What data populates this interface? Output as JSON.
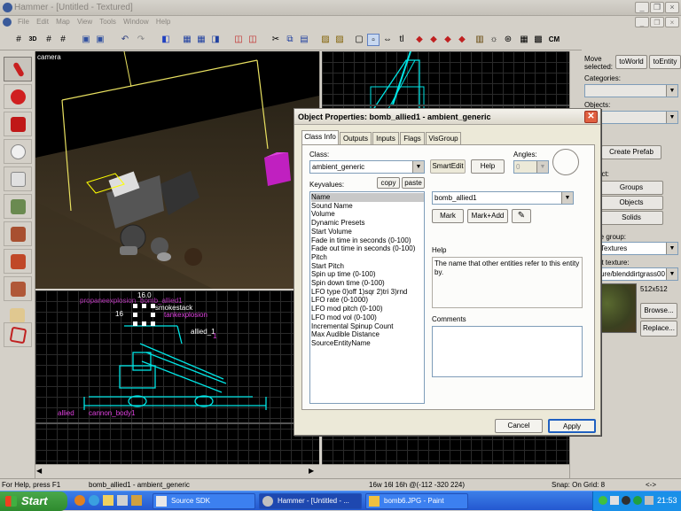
{
  "window": {
    "title": "Hammer - [Untitled - Textured]"
  },
  "menu": [
    "File",
    "Edit",
    "Map",
    "View",
    "Tools",
    "Window",
    "Help"
  ],
  "toolbar": {
    "icons": [
      "grid-icon",
      "grid-3d-icon",
      "grid-smaller-icon",
      "grid-larger-icon",
      "load-window-state-icon",
      "save-window-state-icon",
      "undo-icon",
      "redo-icon",
      "carve-icon",
      "group-icon",
      "ungroup-icon",
      "hide-icon",
      "cut-icon",
      "copy-icon",
      "paste-icon",
      "texture-lock-icon",
      "selection-icon",
      "entity-icon",
      "text-icon",
      "run-map-icon",
      "cordon-icon",
      "cm-icon"
    ],
    "labels": {
      "grid_3d": "3D",
      "text": "tl",
      "cm": "CM"
    }
  },
  "viewports": {
    "camera_label": "camera",
    "top_right_labels": [],
    "bottom_left_labels": [
      "propaneexplosion",
      "bomb_allied1",
      "smokestack",
      "tankexplosion",
      "16.0",
      "16",
      "allied_1",
      "1",
      "allied",
      "cannon_body1"
    ]
  },
  "right_panel": {
    "move_selected_label": "Move selected:",
    "to_world": "toWorld",
    "to_entity": "toEntity",
    "categories_label": "Categories:",
    "objects_label": "Objects:",
    "create_prefab": "Create Prefab",
    "select_label": "ect:",
    "groups": "Groups",
    "objects_btn": "Objects",
    "solids": "Solids",
    "texture_group_label": "re group:",
    "texture_group_value": "Textures",
    "current_texture_label": "nt texture:",
    "current_texture_value": "ure/blenddirtgrass00",
    "texture_size": "512x512",
    "browse": "Browse...",
    "replace": "Replace..."
  },
  "dialog": {
    "title": "Object Properties: bomb_allied1 - ambient_generic",
    "tabs": [
      "Class Info",
      "Outputs",
      "Inputs",
      "Flags",
      "VisGroup"
    ],
    "class_label": "Class:",
    "class_value": "ambient_generic",
    "smartedit": "SmartEdit",
    "help": "Help",
    "angles_label": "Angles:",
    "angles_value": "0",
    "keyvalues_label": "Keyvalues:",
    "copy": "copy",
    "paste": "paste",
    "keyvalues": [
      "Name",
      "Sound Name",
      "Volume",
      "Dynamic Presets",
      "Start Volume",
      "Fade in time in seconds (0-100)",
      "Fade out time in seconds (0-100)",
      "Pitch",
      "Start Pitch",
      "Spin up time (0-100)",
      "Spin down time (0-100)",
      "LFO type 0)off 1)sqr 2)tri 3)rnd",
      "LFO rate (0-1000)",
      "LFO mod pitch (0-100)",
      "LFO mod vol (0-100)",
      "Incremental Spinup Count",
      "Max Audible Distance",
      "SourceEntityName"
    ],
    "value": "bomb_allied1",
    "mark": "Mark",
    "mark_add": "Mark+Add",
    "help_label": "Help",
    "help_text": "The name that other entities refer to this entity by.",
    "comments_label": "Comments",
    "cancel": "Cancel",
    "apply": "Apply"
  },
  "status": {
    "help": "For Help, press F1",
    "selection": "bomb_allied1 - ambient_generic",
    "size": "16w 16l 16h @(-112 -320 224)",
    "grid": "Snap: On Grid: 8",
    "arrows": "<->"
  },
  "taskbar": {
    "start": "Start",
    "tasks": [
      "Source SDK",
      "Hammer - [Untitled - ...",
      "bomb6.JPG - Paint"
    ],
    "clock": "21:53"
  },
  "colors": {
    "wire": "#00e5e5",
    "entity": "#e040e0",
    "selection_box": "#ffff00"
  }
}
